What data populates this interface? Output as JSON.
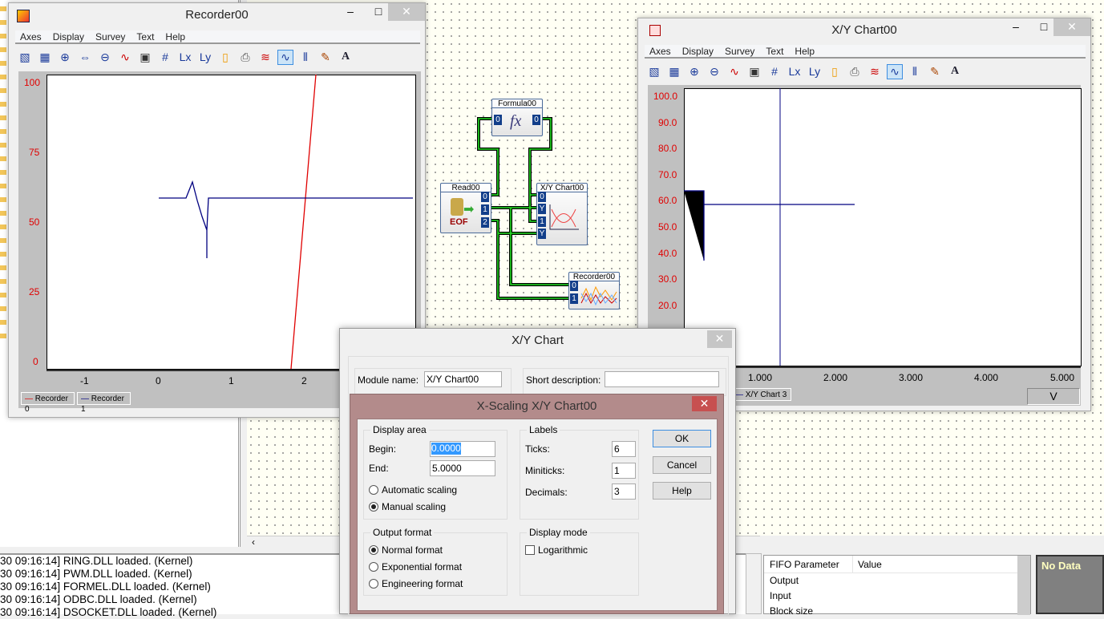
{
  "recorder": {
    "title": "Recorder00",
    "menu": [
      "Axes",
      "Display",
      "Survey",
      "Text",
      "Help"
    ],
    "y_ticks": [
      "100",
      "75",
      "50",
      "25",
      "0"
    ],
    "x_ticks": [
      "-1",
      "0",
      "1",
      "2"
    ],
    "legend": [
      {
        "name": "Recorder 0",
        "color": "#e00000"
      },
      {
        "name": "Recorder 1",
        "color": "#000080"
      }
    ]
  },
  "xychart": {
    "title": "X/Y Chart00",
    "menu": [
      "Axes",
      "Display",
      "Survey",
      "Text",
      "Help"
    ],
    "y_ticks": [
      "100.0",
      "90.0",
      "80.0",
      "70.0",
      "60.0",
      "50.0",
      "40.0",
      "30.0",
      "20.0"
    ],
    "x_ticks": [
      "1.000",
      "2.000",
      "3.000",
      "4.000",
      "5.000"
    ],
    "legend": "X/Y Chart 3",
    "unit": "V"
  },
  "diagram": {
    "formula": "Formula00",
    "formula_icon": "fx",
    "read": "Read00",
    "read_icon": "EOF",
    "xy": "X/Y Chart00",
    "recorder": "Recorder00",
    "ports": {
      "p0": "0",
      "p1": "1",
      "p2": "2",
      "y": "Y"
    }
  },
  "xy_dialog": {
    "title": "X/Y Chart",
    "module_name_label": "Module name:",
    "module_name": "X/Y Chart00",
    "short_desc_label": "Short description:",
    "short_desc": ""
  },
  "xscaling": {
    "title": "X-Scaling X/Y Chart00",
    "display_area": "Display area",
    "begin_label": "Begin:",
    "begin": "0.0000",
    "end_label": "End:",
    "end": "5.0000",
    "auto": "Automatic scaling",
    "manual": "Manual scaling",
    "labels": "Labels",
    "ticks_label": "Ticks:",
    "ticks": "6",
    "miniticks_label": "Miniticks:",
    "miniticks": "1",
    "decimals_label": "Decimals:",
    "decimals": "3",
    "output_format": "Output format",
    "normal": "Normal format",
    "exponential": "Exponential format",
    "engineering": "Engineering format",
    "display_mode": "Display mode",
    "log": "Logarithmic",
    "ok": "OK",
    "cancel": "Cancel",
    "help": "Help"
  },
  "log": [
    "30 09:16:14] RING.DLL loaded. (Kernel)",
    "30 09:16:14] PWM.DLL loaded. (Kernel)",
    "30 09:16:14] FORMEL.DLL loaded. (Kernel)",
    "30 09:16:14] ODBC.DLL loaded. (Kernel)",
    "30 09:16:14] DSOCKET.DLL loaded. (Kernel)"
  ],
  "fifo": {
    "headers": [
      "FIFO Parameter",
      "Value"
    ],
    "rows": [
      "Output",
      "Input",
      "Block size"
    ]
  },
  "nodata": "No Data"
}
